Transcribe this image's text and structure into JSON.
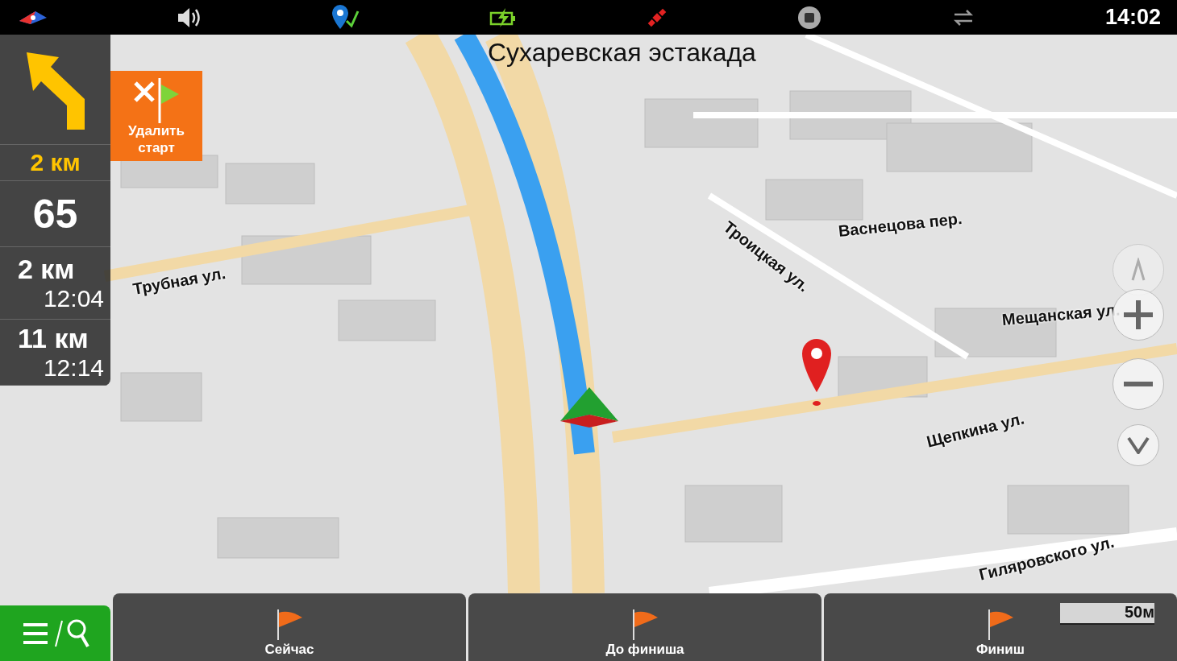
{
  "status_bar": {
    "time": "14:02"
  },
  "street_banner": "Сухаревская эстакада",
  "maneuver": {
    "distance": "2 км"
  },
  "speed": "65",
  "waypoint": {
    "distance": "2 км",
    "eta": "12:04"
  },
  "finish": {
    "distance": "11 км",
    "eta": "12:14"
  },
  "delete_start_button": "Удалить старт",
  "map_labels": [
    {
      "text": "Трубная ул."
    },
    {
      "text": "Троицкая ул."
    },
    {
      "text": "Васнецова пер."
    },
    {
      "text": "Мещанская ул."
    },
    {
      "text": "Щепкина ул."
    },
    {
      "text": "Гиляровского ул."
    }
  ],
  "bottom_tabs": [
    {
      "label": "Сейчас"
    },
    {
      "label": "До финиша"
    },
    {
      "label": "Финиш"
    }
  ],
  "scale": "50м"
}
